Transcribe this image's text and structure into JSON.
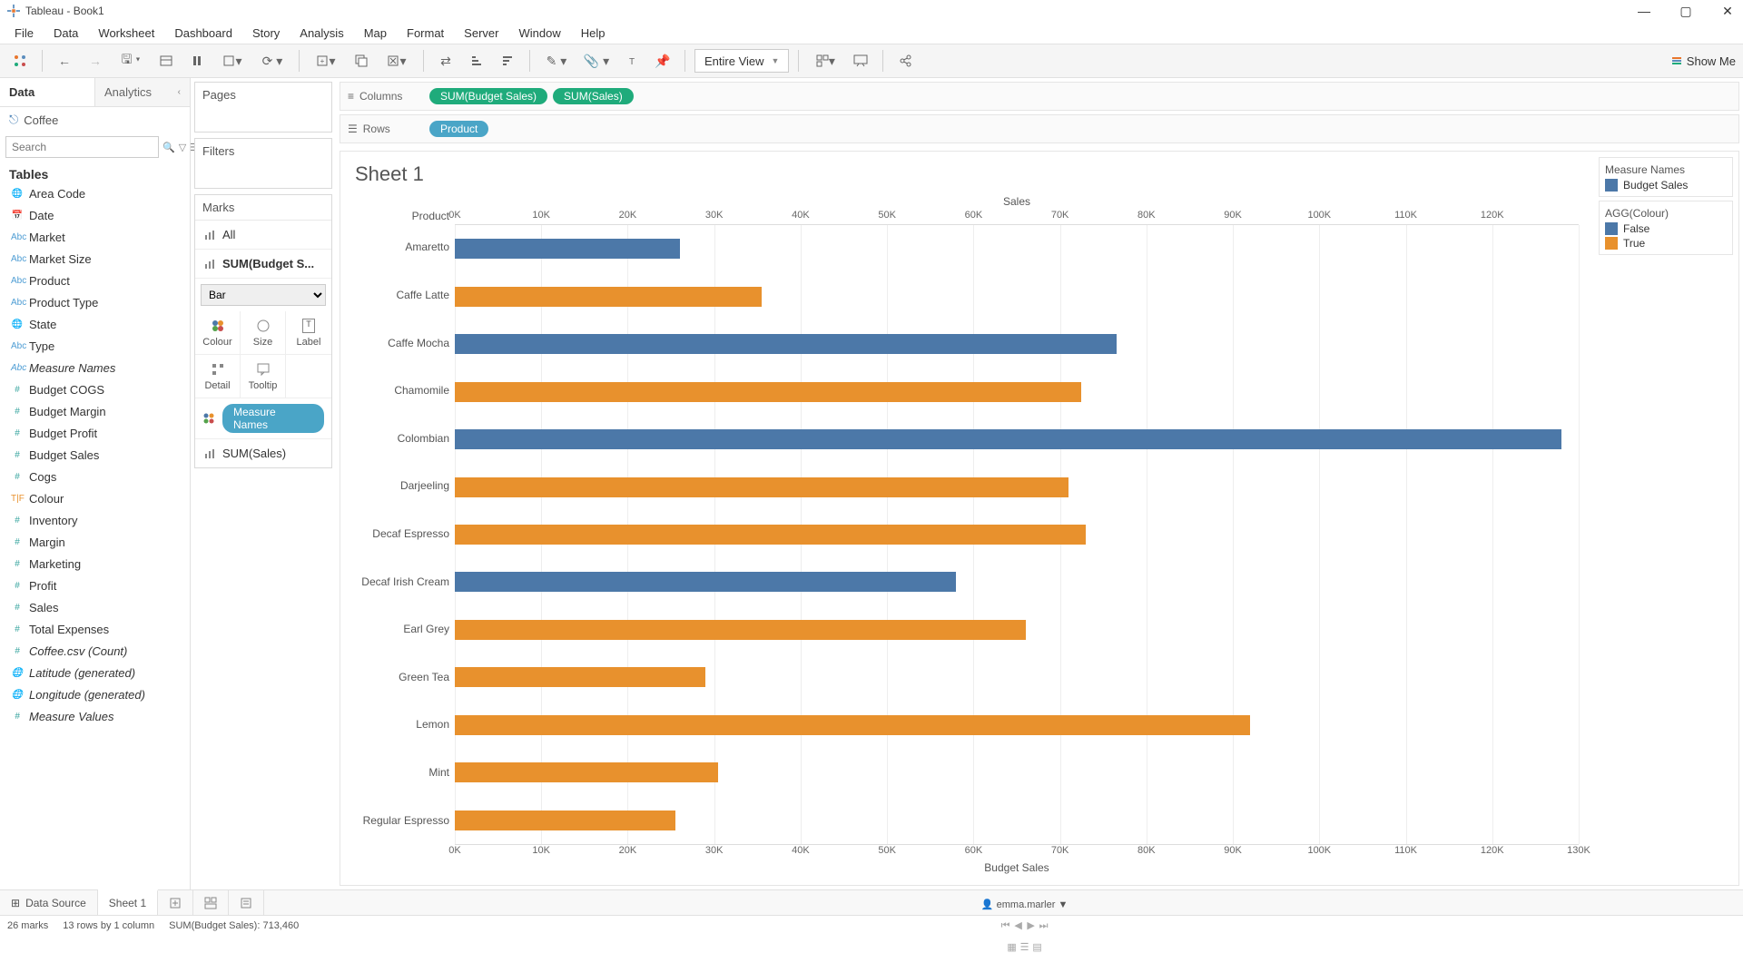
{
  "window": {
    "title": "Tableau - Book1"
  },
  "menu": [
    "File",
    "Data",
    "Worksheet",
    "Dashboard",
    "Story",
    "Analysis",
    "Map",
    "Format",
    "Server",
    "Window",
    "Help"
  ],
  "toolbar": {
    "fit_mode": "Entire View",
    "showme": "Show Me"
  },
  "left": {
    "tabs": {
      "data": "Data",
      "analytics": "Analytics"
    },
    "datasource": "Coffee",
    "search_placeholder": "Search",
    "tables_header": "Tables",
    "fields": [
      {
        "icon": "globe",
        "label": "Area Code",
        "cls": "ic-blue"
      },
      {
        "icon": "date",
        "label": "Date",
        "cls": "ic-blue"
      },
      {
        "icon": "abc",
        "label": "Market",
        "cls": "ic-blue"
      },
      {
        "icon": "abc",
        "label": "Market Size",
        "cls": "ic-blue"
      },
      {
        "icon": "abc",
        "label": "Product",
        "cls": "ic-blue"
      },
      {
        "icon": "abc",
        "label": "Product Type",
        "cls": "ic-blue"
      },
      {
        "icon": "globe",
        "label": "State",
        "cls": "ic-blue"
      },
      {
        "icon": "abc",
        "label": "Type",
        "cls": "ic-blue"
      },
      {
        "icon": "abc",
        "label": "Measure Names",
        "cls": "ic-blue",
        "italic": true
      },
      {
        "icon": "hash",
        "label": "Budget COGS",
        "cls": "ic-teal"
      },
      {
        "icon": "hash",
        "label": "Budget Margin",
        "cls": "ic-teal"
      },
      {
        "icon": "hash",
        "label": "Budget Profit",
        "cls": "ic-teal"
      },
      {
        "icon": "hash",
        "label": "Budget Sales",
        "cls": "ic-teal"
      },
      {
        "icon": "hash",
        "label": "Cogs",
        "cls": "ic-teal"
      },
      {
        "icon": "tf",
        "label": "Colour",
        "cls": "ic-orange"
      },
      {
        "icon": "hash",
        "label": "Inventory",
        "cls": "ic-teal"
      },
      {
        "icon": "hash",
        "label": "Margin",
        "cls": "ic-teal"
      },
      {
        "icon": "hash",
        "label": "Marketing",
        "cls": "ic-teal"
      },
      {
        "icon": "hash",
        "label": "Profit",
        "cls": "ic-teal"
      },
      {
        "icon": "hash",
        "label": "Sales",
        "cls": "ic-teal"
      },
      {
        "icon": "hash",
        "label": "Total Expenses",
        "cls": "ic-teal"
      },
      {
        "icon": "hash",
        "label": "Coffee.csv (Count)",
        "cls": "ic-teal",
        "italic": true
      },
      {
        "icon": "globe",
        "label": "Latitude (generated)",
        "cls": "ic-teal",
        "italic": true
      },
      {
        "icon": "globe",
        "label": "Longitude (generated)",
        "cls": "ic-teal",
        "italic": true
      },
      {
        "icon": "hash",
        "label": "Measure Values",
        "cls": "ic-teal",
        "italic": true
      }
    ]
  },
  "cards": {
    "pages": "Pages",
    "filters": "Filters",
    "marks": "Marks",
    "all": "All",
    "budget": "SUM(Budget S...",
    "sales": "SUM(Sales)",
    "mark_type": "Bar",
    "cells": [
      "Colour",
      "Size",
      "Label",
      "Detail",
      "Tooltip"
    ],
    "measure_names": "Measure Names"
  },
  "shelves": {
    "columns_label": "Columns",
    "rows_label": "Rows",
    "columns": [
      "SUM(Budget Sales)",
      "SUM(Sales)"
    ],
    "rows": [
      "Product"
    ]
  },
  "viz": {
    "title": "Sheet 1",
    "product_header": "Product",
    "top_axis": "Sales",
    "bottom_axis": "Budget Sales"
  },
  "legend": {
    "measure_title": "Measure Names",
    "measure_items": [
      {
        "label": "Budget Sales",
        "color": "#4c78a8"
      }
    ],
    "agg_title": "AGG(Colour)",
    "agg_items": [
      {
        "label": "False",
        "color": "#4c78a8"
      },
      {
        "label": "True",
        "color": "#e8912d"
      }
    ]
  },
  "sheet_tabs": {
    "data_source": "Data Source",
    "sheet": "Sheet 1"
  },
  "status": {
    "marks": "26 marks",
    "dims": "13 rows by 1 column",
    "sum": "SUM(Budget Sales): 713,460",
    "user": "emma.marler"
  },
  "colors": {
    "false": "#4c78a8",
    "true": "#e8912d"
  },
  "chart_data": {
    "type": "bar",
    "orientation": "horizontal",
    "title": "Sheet 1",
    "ylabel": "Product",
    "top_axis": {
      "label": "Sales",
      "ticks": [
        0,
        10000,
        20000,
        30000,
        40000,
        50000,
        60000,
        70000,
        80000,
        90000,
        100000,
        110000,
        120000
      ],
      "tick_labels": [
        "0K",
        "10K",
        "20K",
        "30K",
        "40K",
        "50K",
        "60K",
        "70K",
        "80K",
        "90K",
        "100K",
        "110K",
        "120K"
      ],
      "range": [
        0,
        130000
      ]
    },
    "bottom_axis": {
      "label": "Budget Sales",
      "ticks": [
        0,
        10000,
        20000,
        30000,
        40000,
        50000,
        60000,
        70000,
        80000,
        90000,
        100000,
        110000,
        120000,
        130000
      ],
      "tick_labels": [
        "0K",
        "10K",
        "20K",
        "30K",
        "40K",
        "50K",
        "60K",
        "70K",
        "80K",
        "90K",
        "100K",
        "110K",
        "120K",
        "130K"
      ],
      "range": [
        0,
        130000
      ]
    },
    "color_field": "AGG(Colour)",
    "color_map": {
      "False": "#4c78a8",
      "True": "#e8912d"
    },
    "categories": [
      "Amaretto",
      "Caffe Latte",
      "Caffe Mocha",
      "Chamomile",
      "Colombian",
      "Darjeeling",
      "Decaf Espresso",
      "Decaf Irish Cream",
      "Earl Grey",
      "Green Tea",
      "Lemon",
      "Mint",
      "Regular Espresso"
    ],
    "series": [
      {
        "name": "Budget Sales",
        "values": [
          26000,
          35500,
          76500,
          72500,
          128000,
          71000,
          73000,
          58000,
          66000,
          29000,
          92000,
          30500,
          25500
        ],
        "agg_colour": [
          "False",
          "True",
          "False",
          "True",
          "False",
          "True",
          "True",
          "False",
          "True",
          "True",
          "True",
          "True",
          "True"
        ]
      }
    ]
  }
}
